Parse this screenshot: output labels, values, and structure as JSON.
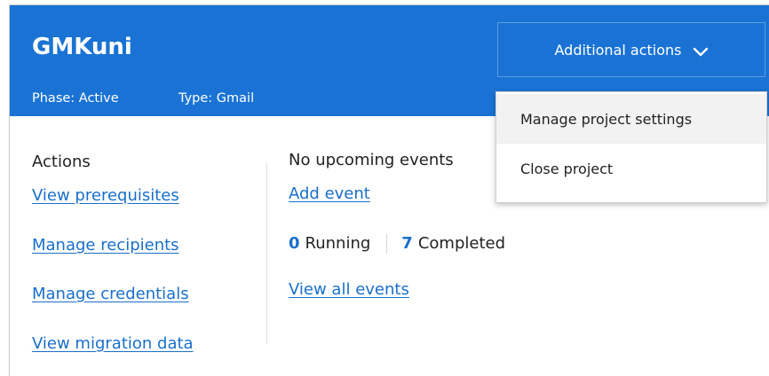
{
  "project": {
    "name": "GMKuni",
    "phase": "Phase: Active",
    "type": "Type: Gmail"
  },
  "actions": {
    "heading": "Actions",
    "links": [
      "View prerequisites",
      "Manage recipients",
      "Manage credentials",
      "View migration data"
    ]
  },
  "events": {
    "empty_text": "No upcoming events",
    "add_link": "Add event",
    "running_count": "0",
    "running_label": "Running",
    "completed_count": "7",
    "completed_label": "Completed",
    "view_all_link": "View all events"
  },
  "additional_actions": {
    "button_label": "Additional actions",
    "icon": "chevron-down-icon",
    "menu_items": [
      "Manage project settings",
      "Close project"
    ]
  },
  "colors": {
    "header_bg": "#1a73d4",
    "link": "#1a6fc8",
    "menu_hover": "#f2f2f2"
  }
}
